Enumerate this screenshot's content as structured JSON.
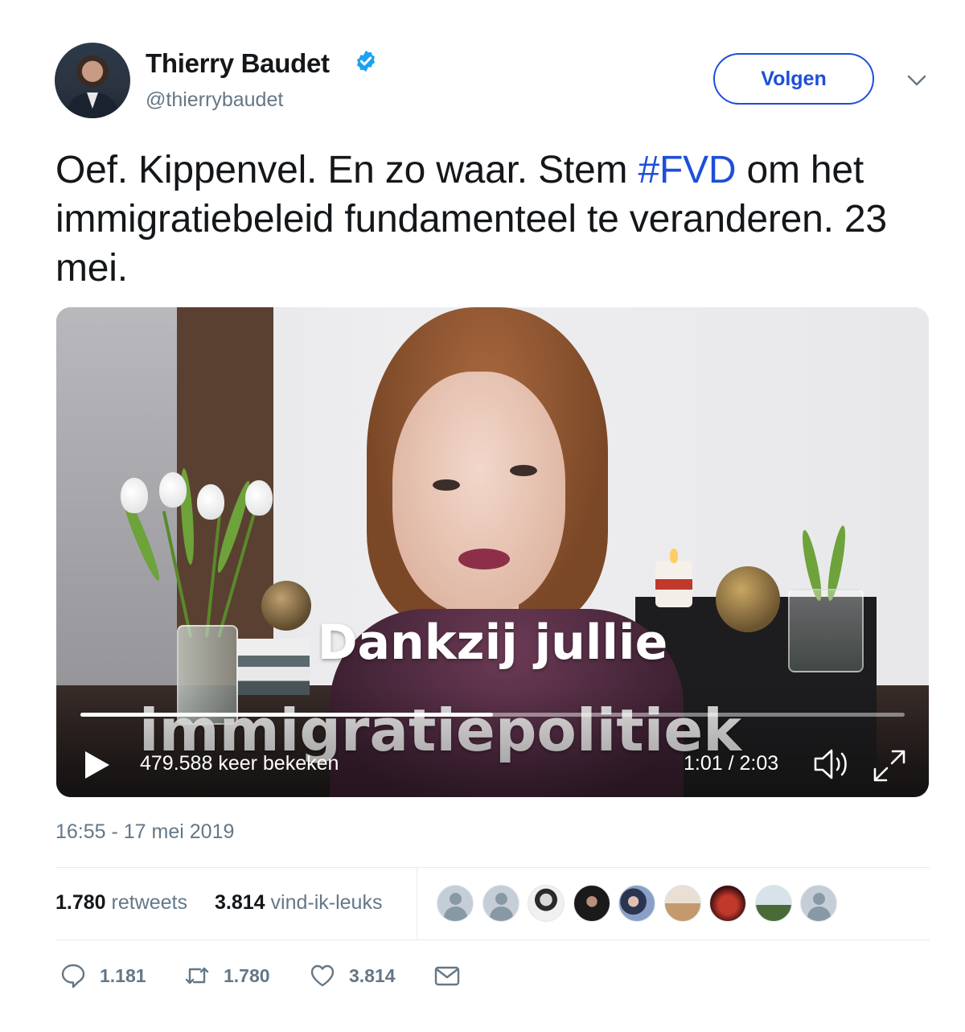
{
  "author": {
    "name": "Thierry Baudet",
    "handle": "@thierrybaudet",
    "verified": true
  },
  "header": {
    "follow_label": "Volgen"
  },
  "tweet": {
    "text_before": "Oef. Kippenvel. En zo waar. Stem ",
    "hashtag": "#FVD",
    "text_after": " om het immigratiebeleid fundamenteel te veranderen. 23 mei."
  },
  "video": {
    "caption_line1": "Dankzij jullie",
    "caption_line2": "immigratiepolitiek",
    "views": "479.588 keer bekeken",
    "time": "1:01 / 2:03",
    "progress": 0.5
  },
  "timestamp": "16:55 - 17 mei 2019",
  "stats": {
    "retweets_count": "1.780",
    "retweets_label": "retweets",
    "likes_count": "3.814",
    "likes_label": "vind-ik-leuks"
  },
  "actions": {
    "replies": "1.181",
    "retweets": "1.780",
    "likes": "3.814"
  },
  "colors": {
    "link": "#1d4fd8",
    "muted": "#657786",
    "verified": "#1da1f2"
  }
}
